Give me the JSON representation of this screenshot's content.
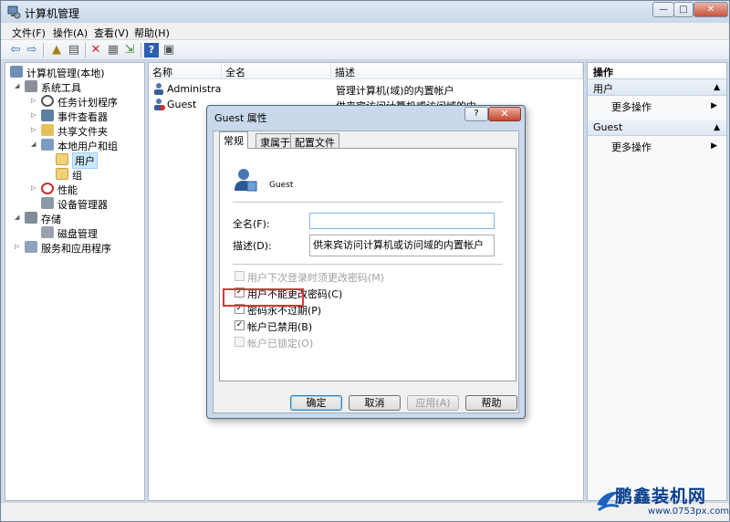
{
  "window": {
    "title": "计算机管理",
    "btn_min": "—",
    "btn_max": "□",
    "btn_close": "✕"
  },
  "menu": [
    "文件(F)",
    "操作(A)",
    "查看(V)",
    "帮助(H)"
  ],
  "tree": {
    "items": [
      {
        "label": "计算机管理(本地)",
        "icon": "computer-icon"
      },
      {
        "label": "系统工具",
        "icon": "tools-icon"
      },
      {
        "label": "任务计划程序",
        "icon": "clock-icon"
      },
      {
        "label": "事件查看器",
        "icon": "event-viewer-icon"
      },
      {
        "label": "共享文件夹",
        "icon": "shared-folder-icon"
      },
      {
        "label": "本地用户和组",
        "icon": "users-icon"
      },
      {
        "label": "用户",
        "icon": "folder-icon"
      },
      {
        "label": "组",
        "icon": "folder-icon"
      },
      {
        "label": "性能",
        "icon": "performance-icon"
      },
      {
        "label": "设备管理器",
        "icon": "device-manager-icon"
      },
      {
        "label": "存储",
        "icon": "storage-icon"
      },
      {
        "label": "磁盘管理",
        "icon": "disk-icon"
      },
      {
        "label": "服务和应用程序",
        "icon": "services-icon"
      }
    ]
  },
  "list": {
    "columns": [
      "名称",
      "全名",
      "描述"
    ],
    "rows": [
      {
        "name": "Administrat...",
        "fullname": "",
        "desc": "管理计算机(域)的内置帐户"
      },
      {
        "name": "Guest",
        "fullname": "",
        "desc": "供来宾访问计算机或访问域的内..."
      }
    ]
  },
  "actions": {
    "header": "操作",
    "sections": [
      {
        "title": "用户",
        "item": "更多操作"
      },
      {
        "title": "Guest",
        "item": "更多操作"
      }
    ]
  },
  "dialog": {
    "title": "Guest 属性",
    "help": "?",
    "close": "✕",
    "tabs": [
      "常规",
      "隶属于",
      "配置文件"
    ],
    "username": "Guest",
    "fullname_label": "全名(F):",
    "fullname_value": "",
    "desc_label": "描述(D):",
    "desc_value": "供来宾访问计算机或访问域的内置帐户",
    "checkboxes": [
      {
        "label": "用户下次登录时须更改密码(M)",
        "checked": false,
        "disabled": true
      },
      {
        "label": "用户不能更改密码(C)",
        "checked": true,
        "disabled": false
      },
      {
        "label": "密码永不过期(P)",
        "checked": true,
        "disabled": false
      },
      {
        "label": "帐户已禁用(B)",
        "checked": true,
        "disabled": false
      },
      {
        "label": "帐户已锁定(O)",
        "checked": false,
        "disabled": true
      }
    ],
    "buttons": {
      "ok": "确定",
      "cancel": "取消",
      "apply": "应用(A)",
      "help": "帮助"
    }
  },
  "watermark": {
    "brand": "鹏鑫装机网",
    "url": "www.0753px.com"
  },
  "colors": {
    "highlight_box": "#d9353a",
    "title_bar": "#c9d8ea",
    "selection": "#cce8ff"
  }
}
